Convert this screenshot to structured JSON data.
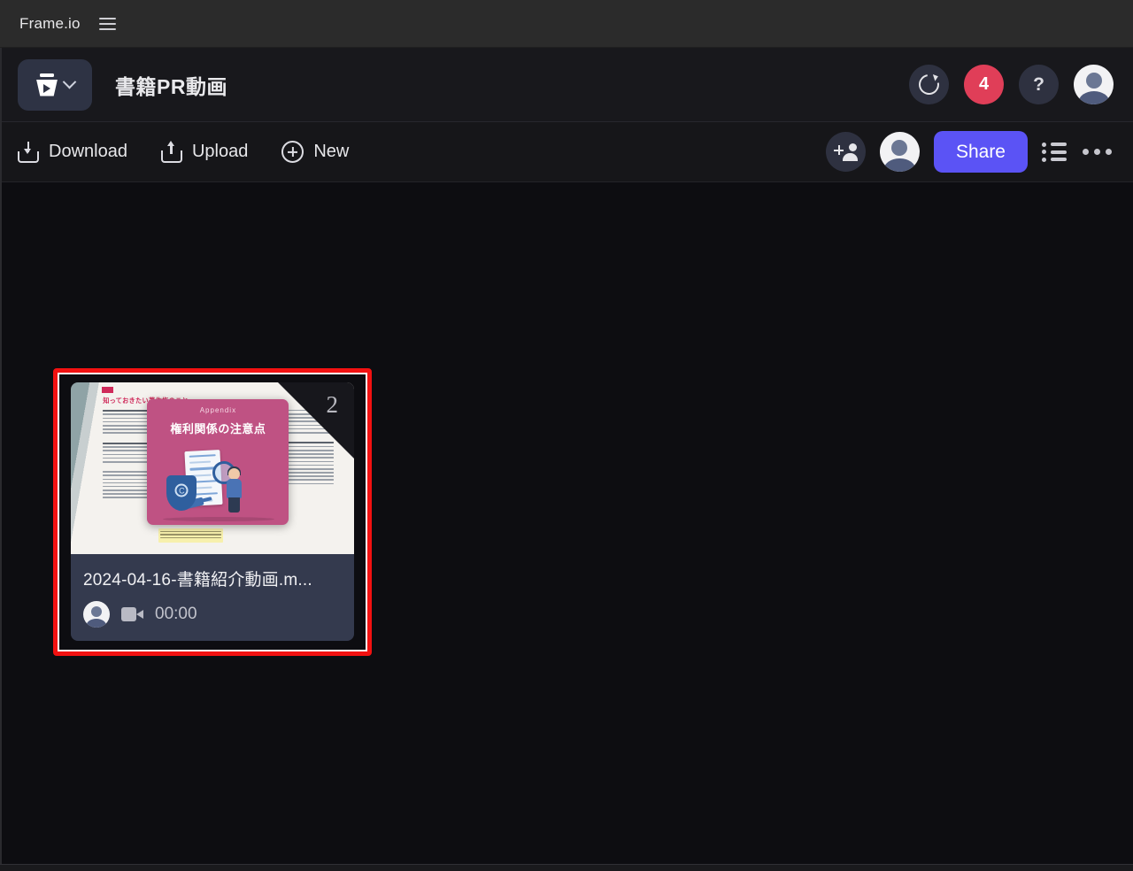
{
  "topbar": {
    "brand": "Frame.io",
    "menu_icon": "hamburger-icon"
  },
  "project_header": {
    "logo_icon": "frameio-logo-icon",
    "chevron_icon": "chevron-down-icon",
    "title": "書籍PR動画",
    "actions": {
      "refresh_icon": "refresh-icon",
      "notification_count": "4",
      "help_label": "?",
      "avatar_icon": "user-avatar"
    }
  },
  "toolbar": {
    "download_label": "Download",
    "download_icon": "download-icon",
    "upload_label": "Upload",
    "upload_icon": "upload-icon",
    "new_label": "New",
    "new_icon": "plus-circle-icon",
    "invite_icon": "add-person-icon",
    "collaborator_avatar": "user-avatar",
    "share_label": "Share",
    "share_color": "#5b53f5",
    "list_view_icon": "list-view-icon",
    "more_icon": "more-horizontal-icon"
  },
  "asset": {
    "page_number": "2",
    "filename": "2024-04-16-書籍紹介動画.m...",
    "duration": "00:00",
    "type_icon": "video-camera-icon",
    "owner_avatar": "user-avatar",
    "selected": true,
    "selection_color": "#f21111",
    "thumbnail": {
      "page_heading": "知っておきたい著作権のこと",
      "slide_kicker": "Appendix",
      "slide_title": "権利関係の注意点",
      "slide_color": "#bf5283"
    }
  }
}
